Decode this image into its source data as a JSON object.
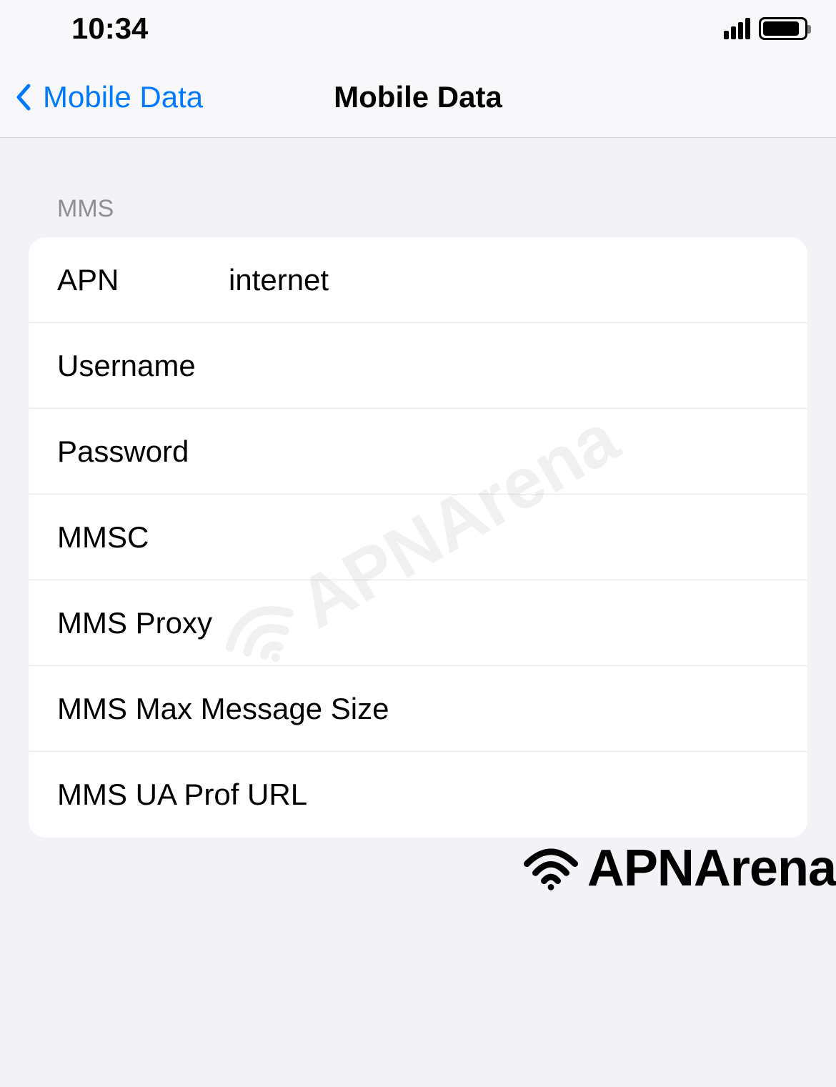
{
  "status_bar": {
    "time": "10:34"
  },
  "nav": {
    "back_label": "Mobile Data",
    "title": "Mobile Data"
  },
  "section": {
    "header": "MMS"
  },
  "fields": {
    "apn": {
      "label": "APN",
      "value": "internet"
    },
    "username": {
      "label": "Username",
      "value": ""
    },
    "password": {
      "label": "Password",
      "value": ""
    },
    "mmsc": {
      "label": "MMSC",
      "value": ""
    },
    "mms_proxy": {
      "label": "MMS Proxy",
      "value": ""
    },
    "mms_max_size": {
      "label": "MMS Max Message Size",
      "value": ""
    },
    "mms_ua_prof": {
      "label": "MMS UA Prof URL",
      "value": ""
    }
  },
  "watermark": {
    "text": "APNArena"
  },
  "footer": {
    "brand": "APNArena"
  }
}
